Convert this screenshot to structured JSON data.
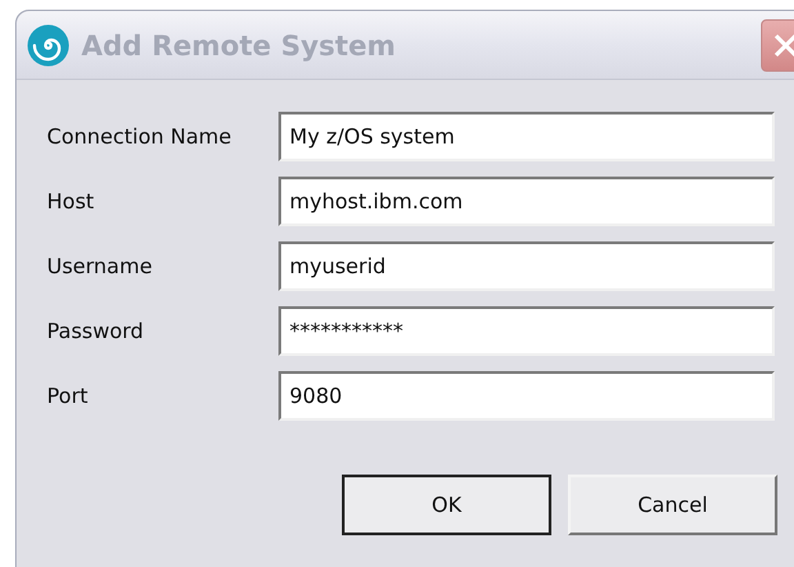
{
  "window": {
    "title": "Add Remote System"
  },
  "fields": [
    {
      "label": "Connection Name",
      "value": "My z/OS system"
    },
    {
      "label": "Host",
      "value": "myhost.ibm.com"
    },
    {
      "label": "Username",
      "value": "myuserid"
    },
    {
      "label": "Password",
      "value": "***********"
    },
    {
      "label": "Port",
      "value": "9080"
    }
  ],
  "buttons": [
    {
      "label": "OK",
      "default": true
    },
    {
      "label": "Cancel",
      "default": false
    }
  ]
}
